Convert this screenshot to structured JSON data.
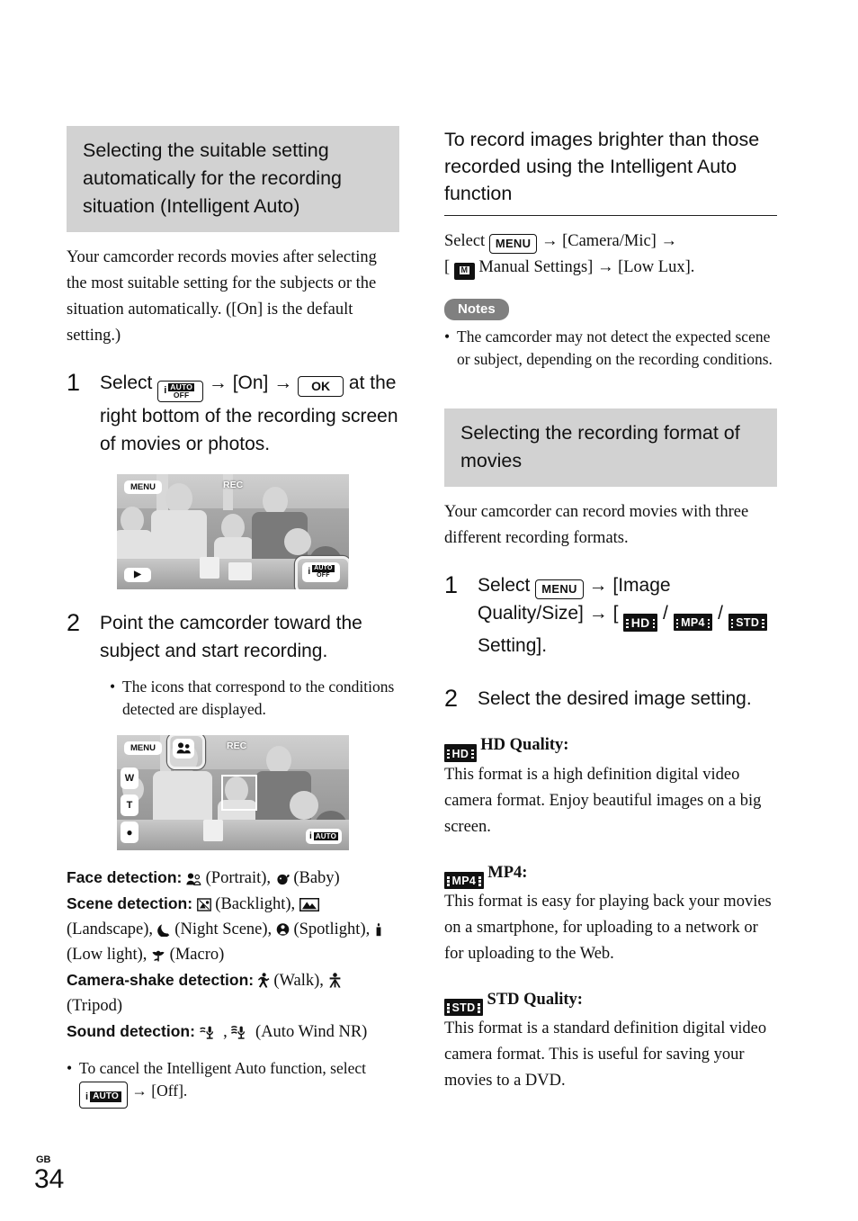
{
  "page": {
    "locale_code": "GB",
    "number": "34"
  },
  "left": {
    "heading": "Selecting the suitable setting automatically for the recording situation (Intelligent Auto)",
    "intro": "Your camcorder records movies after selecting the most suitable setting for the subjects or the situation automatically. ([On] is the default setting.)",
    "steps": [
      {
        "number": "1",
        "text_1": "Select",
        "icon_1": "i-auto-off-icon",
        "arrow": "→",
        "text_2": "[On]",
        "icon_2": "ok-icon",
        "text_3": "at the right bottom of the recording screen of movies or photos."
      },
      {
        "number": "2",
        "text": "Point the camcorder toward the subject and start recording.",
        "bullet": "The icons that correspond to the conditions detected are displayed."
      }
    ],
    "screen_1": {
      "menu_label": "MENU",
      "rec_label": "REC",
      "play_label": "▶",
      "iauto_label": "i AUTO OFF"
    },
    "screen_2": {
      "menu_label": "MENU",
      "rec_label": "REC",
      "zoom_wide_label": "W",
      "zoom_tele_label": "T",
      "record_label": "●",
      "iauto_label": "i AUTO",
      "detected_icon": "portrait-detection-icon"
    },
    "detections": [
      {
        "label": "Face detection:",
        "items": [
          {
            "icon": "portrait-icon",
            "name": "(Portrait),"
          },
          {
            "icon": "baby-icon",
            "name": "(Baby)"
          }
        ]
      },
      {
        "label": "Scene detection:",
        "items": [
          {
            "icon": "backlight-icon",
            "name": "(Backlight),"
          },
          {
            "icon": "landscape-icon",
            "name": "(Landscape),"
          },
          {
            "icon": "night-scene-icon",
            "name": "(Night Scene),"
          },
          {
            "icon": "spotlight-icon",
            "name": "(Spotlight),"
          },
          {
            "icon": "low-light-icon",
            "name": "(Low light),"
          },
          {
            "icon": "macro-icon",
            "name": "(Macro)"
          }
        ]
      },
      {
        "label": "Camera-shake detection:",
        "items": [
          {
            "icon": "walk-icon",
            "name": "(Walk),"
          },
          {
            "icon": "tripod-icon",
            "name": "(Tripod)"
          }
        ]
      },
      {
        "label": "Sound detection:",
        "items": [
          {
            "icon": "wind-mic-low-icon",
            "name": ","
          },
          {
            "icon": "wind-mic-high-icon",
            "name": "(Auto Wind NR)"
          }
        ]
      }
    ],
    "cancel_bullet": {
      "text_1": "To cancel the Intelligent Auto function, select",
      "icon": "i-auto-icon",
      "arrow": "→",
      "text_2": "[Off]."
    }
  },
  "right": {
    "heading_1": "To record images brighter than those recorded using the Intelligent Auto function",
    "select_line": {
      "select_label": "Select",
      "menu_chip": "MENU",
      "arrow": "→",
      "item_1": "[Camera/Mic]",
      "bracket_open": "[",
      "manual_icon": "manual-settings-icon",
      "item_2": "Manual Settings]",
      "item_3": "[Low Lux]."
    },
    "notes_label": "Notes",
    "notes_items": [
      "The camcorder may not detect the expected scene or subject, depending on the recording conditions."
    ],
    "heading_2": "Selecting the recording format of movies",
    "intro_2": "Your camcorder can record movies with three different recording formats.",
    "steps": [
      {
        "number": "1",
        "select_label": "Select",
        "menu_chip": "MENU",
        "arrow": "→",
        "part_1": "[Image Quality/Size]",
        "bracket_open": "[",
        "badge_hd": "HD",
        "slash": "/",
        "badge_mp4": "MP4",
        "badge_std": "STD",
        "part_2": "Setting]."
      },
      {
        "number": "2",
        "text": "Select the desired image setting."
      }
    ],
    "formats": [
      {
        "badge": "HD",
        "title": "HD Quality:",
        "body": "This format is a high definition digital video camera format. Enjoy beautiful images on a big screen."
      },
      {
        "badge": "MP4",
        "title": "MP4:",
        "body": "This format is easy for playing back your movies on a smartphone, for uploading to a network or for uploading to the Web."
      },
      {
        "badge": "STD",
        "title": "STD Quality:",
        "body": "This format is a standard definition digital video camera format. This is useful for saving your movies to a DVD."
      }
    ]
  },
  "colors": {
    "heading_band": "#d2d2d2",
    "notes_pill": "#808080",
    "text": "#111111"
  }
}
